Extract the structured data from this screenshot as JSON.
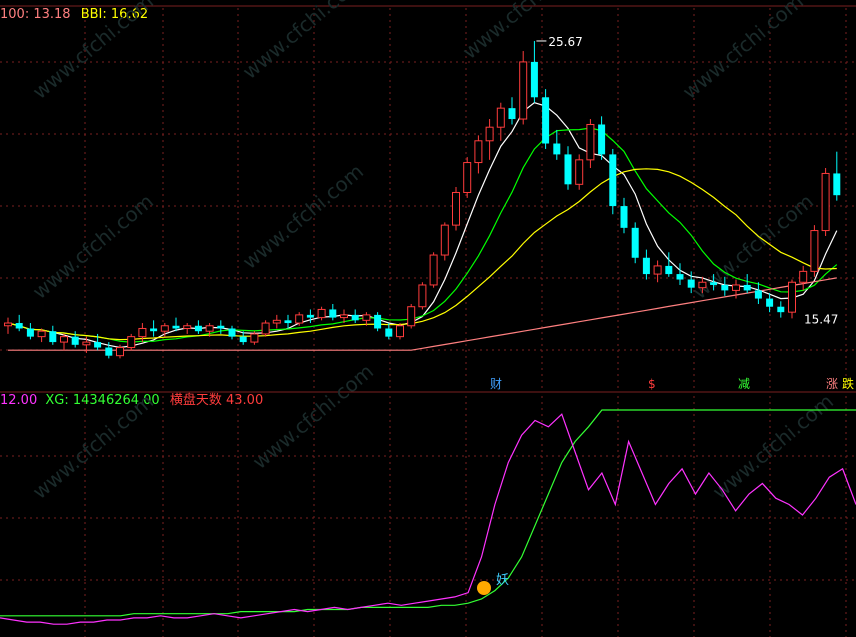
{
  "top_legend": {
    "ma100_label": "100:",
    "ma100_value": "13.18",
    "bbi_label": "BBI:",
    "bbi_value": "16.62"
  },
  "bottom_legend": {
    "value1": "12.00",
    "xg_label": "XG:",
    "xg_value": "14346264.00",
    "hengpan_label": "横盘天数",
    "hengpan_value": "43.00"
  },
  "markers": {
    "cai": "财",
    "s": "$",
    "jian": "减",
    "zhang": "涨",
    "die": "跌",
    "yao": "妖"
  },
  "price_labels": {
    "high": "25.67",
    "low": "15.47"
  },
  "watermark": "www.cfchi.com",
  "colors": {
    "background": "#000000",
    "up": "#ff3c3c",
    "down": "#00ffff",
    "ma_white": "#ffffff",
    "ma_yellow": "#ffff00",
    "ma_green": "#00ff00",
    "ma_pink": "#ff8080",
    "xg_line": "#33ff33",
    "magenta": "#ff33ff",
    "grid": "#7a1f1f"
  },
  "chart_data": {
    "type": "candlestick",
    "ohlc_approx": [
      [
        15.2,
        15.5,
        14.9,
        15.3
      ],
      [
        15.3,
        15.6,
        15.0,
        15.1
      ],
      [
        15.1,
        15.3,
        14.7,
        14.8
      ],
      [
        14.8,
        15.1,
        14.6,
        15.0
      ],
      [
        15.0,
        15.2,
        14.5,
        14.6
      ],
      [
        14.6,
        14.9,
        14.3,
        14.8
      ],
      [
        14.8,
        15.0,
        14.4,
        14.5
      ],
      [
        14.5,
        14.8,
        14.2,
        14.6
      ],
      [
        14.6,
        14.9,
        14.3,
        14.4
      ],
      [
        14.4,
        14.6,
        14.0,
        14.1
      ],
      [
        14.1,
        14.5,
        14.0,
        14.4
      ],
      [
        14.4,
        14.9,
        14.3,
        14.8
      ],
      [
        14.8,
        15.3,
        14.6,
        15.1
      ],
      [
        15.1,
        15.4,
        14.8,
        15.0
      ],
      [
        15.0,
        15.3,
        14.8,
        15.2
      ],
      [
        15.2,
        15.5,
        15.0,
        15.1
      ],
      [
        15.1,
        15.3,
        14.9,
        15.2
      ],
      [
        15.2,
        15.4,
        14.9,
        15.0
      ],
      [
        15.0,
        15.3,
        14.8,
        15.2
      ],
      [
        15.2,
        15.4,
        14.9,
        15.1
      ],
      [
        15.1,
        15.2,
        14.7,
        14.8
      ],
      [
        14.8,
        15.0,
        14.5,
        14.6
      ],
      [
        14.6,
        15.0,
        14.5,
        14.9
      ],
      [
        14.9,
        15.4,
        14.8,
        15.3
      ],
      [
        15.3,
        15.6,
        15.1,
        15.4
      ],
      [
        15.4,
        15.6,
        15.1,
        15.3
      ],
      [
        15.3,
        15.7,
        15.2,
        15.6
      ],
      [
        15.6,
        15.8,
        15.3,
        15.5
      ],
      [
        15.5,
        15.9,
        15.4,
        15.8
      ],
      [
        15.8,
        16.0,
        15.4,
        15.5
      ],
      [
        15.5,
        15.8,
        15.3,
        15.6
      ],
      [
        15.6,
        15.8,
        15.3,
        15.4
      ],
      [
        15.4,
        15.7,
        15.2,
        15.6
      ],
      [
        15.6,
        15.7,
        15.0,
        15.1
      ],
      [
        15.1,
        15.3,
        14.7,
        14.8
      ],
      [
        14.8,
        15.3,
        14.7,
        15.2
      ],
      [
        15.2,
        16.0,
        15.1,
        15.9
      ],
      [
        15.9,
        16.8,
        15.8,
        16.7
      ],
      [
        16.7,
        17.9,
        16.6,
        17.8
      ],
      [
        17.8,
        19.0,
        17.6,
        18.9
      ],
      [
        18.9,
        20.3,
        18.7,
        20.1
      ],
      [
        20.1,
        21.4,
        19.9,
        21.2
      ],
      [
        21.2,
        22.2,
        20.8,
        22.0
      ],
      [
        22.0,
        22.8,
        21.3,
        22.5
      ],
      [
        22.5,
        23.4,
        22.0,
        23.2
      ],
      [
        23.2,
        23.6,
        22.6,
        22.8
      ],
      [
        22.8,
        25.3,
        22.6,
        24.9
      ],
      [
        24.9,
        25.67,
        23.4,
        23.6
      ],
      [
        23.6,
        23.9,
        21.7,
        21.9
      ],
      [
        21.9,
        22.4,
        21.3,
        21.5
      ],
      [
        21.5,
        21.8,
        20.2,
        20.4
      ],
      [
        20.4,
        21.5,
        20.2,
        21.3
      ],
      [
        21.3,
        22.8,
        21.0,
        22.6
      ],
      [
        22.6,
        22.9,
        21.3,
        21.5
      ],
      [
        21.5,
        21.7,
        19.3,
        19.6
      ],
      [
        19.6,
        19.9,
        18.6,
        18.8
      ],
      [
        18.8,
        19.0,
        17.5,
        17.7
      ],
      [
        17.7,
        18.0,
        16.9,
        17.1
      ],
      [
        17.1,
        17.6,
        16.8,
        17.4
      ],
      [
        17.4,
        17.9,
        17.0,
        17.1
      ],
      [
        17.1,
        17.5,
        16.7,
        16.9
      ],
      [
        16.9,
        17.2,
        16.4,
        16.6
      ],
      [
        16.6,
        17.0,
        16.4,
        16.8
      ],
      [
        16.8,
        17.1,
        16.5,
        16.7
      ],
      [
        16.7,
        17.0,
        16.3,
        16.5
      ],
      [
        16.5,
        16.9,
        16.2,
        16.7
      ],
      [
        16.7,
        17.1,
        16.4,
        16.5
      ],
      [
        16.5,
        16.8,
        16.0,
        16.2
      ],
      [
        16.2,
        16.4,
        15.7,
        15.9
      ],
      [
        15.9,
        16.1,
        15.5,
        15.7
      ],
      [
        15.7,
        16.9,
        15.47,
        16.8
      ],
      [
        16.8,
        17.4,
        16.5,
        17.2
      ],
      [
        17.2,
        18.9,
        17.0,
        18.7
      ],
      [
        18.7,
        21.0,
        18.5,
        20.8
      ],
      [
        20.8,
        21.6,
        19.8,
        20.0
      ]
    ],
    "xg_series_approx": [
      2,
      2,
      2,
      2,
      2,
      2,
      2,
      2,
      2,
      2,
      3,
      3,
      3,
      3,
      3,
      3,
      3,
      3,
      4,
      4,
      4,
      4,
      4,
      5,
      5,
      5,
      5,
      6,
      6,
      6,
      6,
      6,
      6,
      7,
      7,
      8,
      10,
      14,
      20,
      30,
      45,
      60,
      75,
      85,
      92,
      100,
      100,
      100,
      100,
      100,
      100,
      100,
      100,
      100,
      100,
      100,
      100,
      100,
      100,
      100,
      100,
      100,
      100,
      100,
      100
    ],
    "hengpan_series_approx": [
      1,
      0,
      -1,
      -1,
      -2,
      -2,
      -1,
      -1,
      0,
      0,
      1,
      1,
      2,
      1,
      1,
      2,
      3,
      2,
      1,
      2,
      3,
      4,
      5,
      4,
      5,
      6,
      5,
      6,
      7,
      8,
      7,
      8,
      9,
      10,
      11,
      13,
      30,
      55,
      75,
      88,
      95,
      92,
      98,
      80,
      62,
      70,
      55,
      85,
      70,
      55,
      65,
      72,
      60,
      70,
      62,
      52,
      60,
      65,
      58,
      55,
      50,
      58,
      68,
      72,
      55
    ]
  }
}
